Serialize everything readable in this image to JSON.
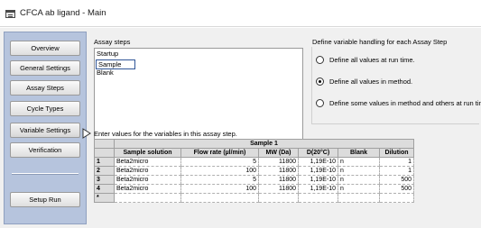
{
  "window": {
    "title": "CFCA ab ligand - Main"
  },
  "sidebar": {
    "items": [
      {
        "label": "Overview"
      },
      {
        "label": "General Settings"
      },
      {
        "label": "Assay Steps"
      },
      {
        "label": "Cycle Types"
      },
      {
        "label": "Variable Settings"
      },
      {
        "label": "Verification"
      },
      {
        "label": "Setup Run"
      }
    ]
  },
  "assay_steps": {
    "label": "Assay steps",
    "items": [
      "Startup",
      "Sample",
      "Blank"
    ],
    "selected": "Sample"
  },
  "variable_handling": {
    "label": "Define variable handling for each Assay Step",
    "options": [
      {
        "label": "Define all values at run time.",
        "selected": false
      },
      {
        "label": "Define all values in method.",
        "selected": true
      },
      {
        "label": "Define some values in method and others at run time.",
        "selected": false
      }
    ]
  },
  "values": {
    "label": "Enter values for the variables in this assay step.",
    "group_header": "Sample 1",
    "columns": [
      "Sample solution",
      "Flow rate (µl/min)",
      "MW (Da)",
      "D(20°C)",
      "Blank",
      "Dilution"
    ],
    "rows": [
      {
        "num": "1",
        "cells": [
          "Beta2micro",
          "5",
          "11800",
          "1,19E-10",
          "n",
          "1"
        ]
      },
      {
        "num": "2",
        "cells": [
          "Beta2micro",
          "100",
          "11800",
          "1,19E-10",
          "n",
          "1"
        ]
      },
      {
        "num": "3",
        "cells": [
          "Beta2micro",
          "5",
          "11800",
          "1,19E-10",
          "n",
          "500"
        ]
      },
      {
        "num": "4",
        "cells": [
          "Beta2micro",
          "100",
          "11800",
          "1,19E-10",
          "n",
          "500"
        ]
      }
    ],
    "new_row_marker": "*"
  }
}
